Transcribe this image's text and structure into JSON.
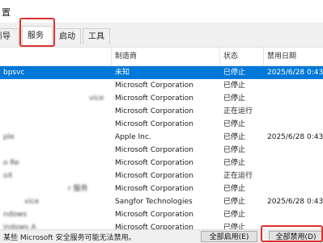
{
  "window": {
    "title_partial": "置"
  },
  "tabs": [
    {
      "label": "引导"
    },
    {
      "label": "服务"
    },
    {
      "label": "启动"
    },
    {
      "label": "工具"
    }
  ],
  "columns": {
    "name": "",
    "manufacturer": "制造商",
    "status": "状态",
    "disabled_date": "禁用日期"
  },
  "rows": [
    {
      "name": "bpsvc",
      "manufacturer": "未知",
      "status": "已停止",
      "date": "2025/6/28 0:43"
    },
    {
      "name": "",
      "manufacturer": "Microsoft Corporation",
      "status": "已停止",
      "date": ""
    },
    {
      "name": "vice",
      "manufacturer": "Microsoft Corporation",
      "status": "已停止",
      "date": ""
    },
    {
      "name": "",
      "manufacturer": "Microsoft Corporation",
      "status": "正在运行",
      "date": ""
    },
    {
      "name": "",
      "manufacturer": "Microsoft Corporation",
      "status": "已停止",
      "date": ""
    },
    {
      "name": "ple",
      "manufacturer": "Apple Inc.",
      "status": "已停止",
      "date": "2025/6/28 0:43"
    },
    {
      "name": "",
      "manufacturer": "Microsoft Corporation",
      "status": "已停止",
      "date": ""
    },
    {
      "name": "o Re",
      "manufacturer": "Microsoft Corporation",
      "status": "已停止",
      "date": ""
    },
    {
      "name": "oX",
      "manufacturer": "Microsoft Corporation",
      "status": "正在运行",
      "date": ""
    },
    {
      "name": "r 服务",
      "manufacturer": "Microsoft Corporation",
      "status": "已停止",
      "date": ""
    },
    {
      "name": "vice",
      "manufacturer": "Sangfor Technologies",
      "status": "已停止",
      "date": "2025/6/28 0:43"
    },
    {
      "name": "ndows",
      "manufacturer": "Microsoft Corporation",
      "status": "已停止",
      "date": ""
    },
    {
      "name": "indows A",
      "manufacturer": "Microsoft Corporation",
      "status": "已停止",
      "date": ""
    }
  ],
  "footer": {
    "hint": "某些 Microsoft 安全服务可能无法禁用。",
    "enable_all": "全部启用(E)",
    "disable_all": "全部禁用(D)"
  }
}
